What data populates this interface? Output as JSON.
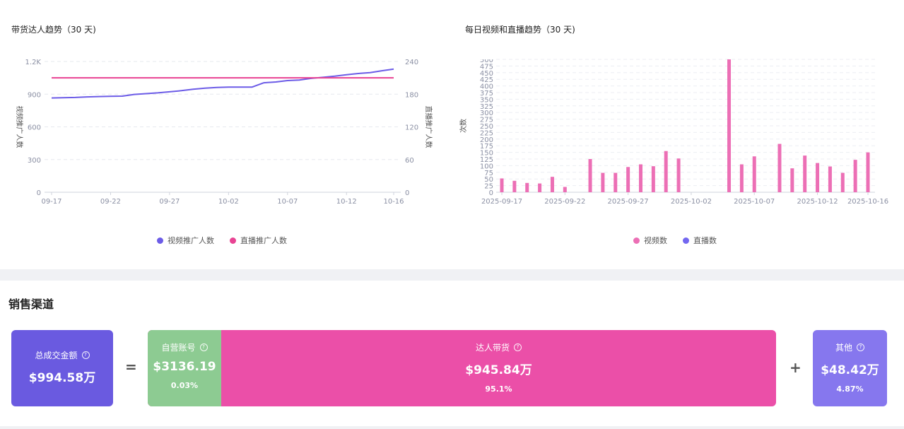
{
  "left_chart": {
    "title": "带货达人趋势（30 天)",
    "legend": [
      {
        "label": "视频推广人数",
        "color": "#6c5ce7"
      },
      {
        "label": "直播推广人数",
        "color": "#e84393"
      }
    ]
  },
  "right_chart": {
    "title": "每日视频和直播趋势（30 天)",
    "legend": [
      {
        "label": "视频数",
        "color": "#ec6fb5"
      },
      {
        "label": "直播数",
        "color": "#7367f0"
      }
    ]
  },
  "chart_data": [
    {
      "type": "line",
      "title": "带货达人趋势（30 天)",
      "ylabel": "视频推广人数",
      "y2label": "直播推广人数",
      "ylim": [
        0,
        1200
      ],
      "y2lim": [
        0,
        240
      ],
      "yticks": [
        "0",
        "300",
        "600",
        "900",
        "1.2K"
      ],
      "y2ticks": [
        "0",
        "60",
        "120",
        "180",
        "240"
      ],
      "xticks": [
        "09-17",
        "09-22",
        "09-27",
        "10-02",
        "10-07",
        "10-12",
        "10-16"
      ],
      "x": [
        "09-17",
        "09-18",
        "09-19",
        "09-20",
        "09-21",
        "09-22",
        "09-23",
        "09-24",
        "09-25",
        "09-26",
        "09-27",
        "09-28",
        "09-29",
        "09-30",
        "10-01",
        "10-02",
        "10-03",
        "10-04",
        "10-05",
        "10-06",
        "10-07",
        "10-08",
        "10-09",
        "10-10",
        "10-11",
        "10-12",
        "10-13",
        "10-14",
        "10-15",
        "10-16"
      ],
      "series": [
        {
          "name": "视频推广人数",
          "axis": "left",
          "color": "#6c5ce7",
          "values": [
            865,
            868,
            870,
            875,
            878,
            880,
            882,
            898,
            905,
            912,
            922,
            932,
            945,
            955,
            962,
            965,
            965,
            965,
            1005,
            1012,
            1025,
            1030,
            1045,
            1055,
            1065,
            1078,
            1090,
            1098,
            1115,
            1130
          ]
        },
        {
          "name": "直播推广人数",
          "axis": "right",
          "color": "#e84393",
          "values": [
            210,
            210,
            210,
            210,
            210,
            210,
            210,
            210,
            210,
            210,
            210,
            210,
            210,
            210,
            210,
            210,
            210,
            210,
            210,
            210,
            210,
            210,
            210,
            210,
            210,
            210,
            210,
            210,
            210,
            210
          ]
        }
      ],
      "legend": "bottom"
    },
    {
      "type": "bar",
      "title": "每日视频和直播趋势（30 天)",
      "ylabel": "次数",
      "ylim": [
        0,
        500
      ],
      "yticks": [
        "0",
        "25",
        "50",
        "75",
        "100",
        "125",
        "150",
        "175",
        "200",
        "225",
        "250",
        "275",
        "300",
        "325",
        "350",
        "375",
        "400",
        "425",
        "450",
        "475",
        "500"
      ],
      "xticks": [
        "2025-09-17",
        "2025-09-22",
        "2025-09-27",
        "2025-10-02",
        "2025-10-07",
        "2025-10-12",
        "2025-10-16"
      ],
      "categories": [
        "2025-09-17",
        "2025-09-18",
        "2025-09-19",
        "2025-09-20",
        "2025-09-21",
        "2025-09-22",
        "2025-09-23",
        "2025-09-24",
        "2025-09-25",
        "2025-09-26",
        "2025-09-27",
        "2025-09-28",
        "2025-09-29",
        "2025-09-30",
        "2025-10-01",
        "2025-10-02",
        "2025-10-03",
        "2025-10-04",
        "2025-10-05",
        "2025-10-06",
        "2025-10-07",
        "2025-10-08",
        "2025-10-09",
        "2025-10-10",
        "2025-10-11",
        "2025-10-12",
        "2025-10-13",
        "2025-10-14",
        "2025-10-15",
        "2025-10-16"
      ],
      "series": [
        {
          "name": "视频数",
          "color": "#ec6fb5",
          "values": [
            52,
            43,
            35,
            33,
            58,
            20,
            0,
            125,
            73,
            73,
            95,
            105,
            98,
            155,
            127,
            0,
            0,
            0,
            510,
            105,
            135,
            0,
            182,
            90,
            138,
            110,
            97,
            73,
            122,
            150
          ]
        },
        {
          "name": "直播数",
          "color": "#7367f0",
          "values": [
            0,
            0,
            0,
            0,
            0,
            0,
            0,
            0,
            0,
            0,
            0,
            0,
            0,
            0,
            0,
            0,
            0,
            0,
            0,
            0,
            0,
            0,
            0,
            0,
            0,
            0,
            0,
            0,
            0,
            0
          ]
        }
      ],
      "legend": "bottom"
    }
  ],
  "sales_channel": {
    "title": "销售渠道",
    "total": {
      "label": "总成交金额",
      "amount": "$994.58万",
      "color": "#6a5ae0"
    },
    "equals": "=",
    "plus": "+",
    "self_account": {
      "label": "自营账号",
      "amount": "$3136.19",
      "percent": "0.03%",
      "color": "#8dcb92"
    },
    "influencer": {
      "label": "达人带货",
      "amount": "$945.84万",
      "percent": "95.1%",
      "color": "#eb4fa8"
    },
    "other": {
      "label": "其他",
      "amount": "$48.42万",
      "percent": "4.87%",
      "color": "#8677ee"
    },
    "help_icon": "question-circle-icon"
  }
}
